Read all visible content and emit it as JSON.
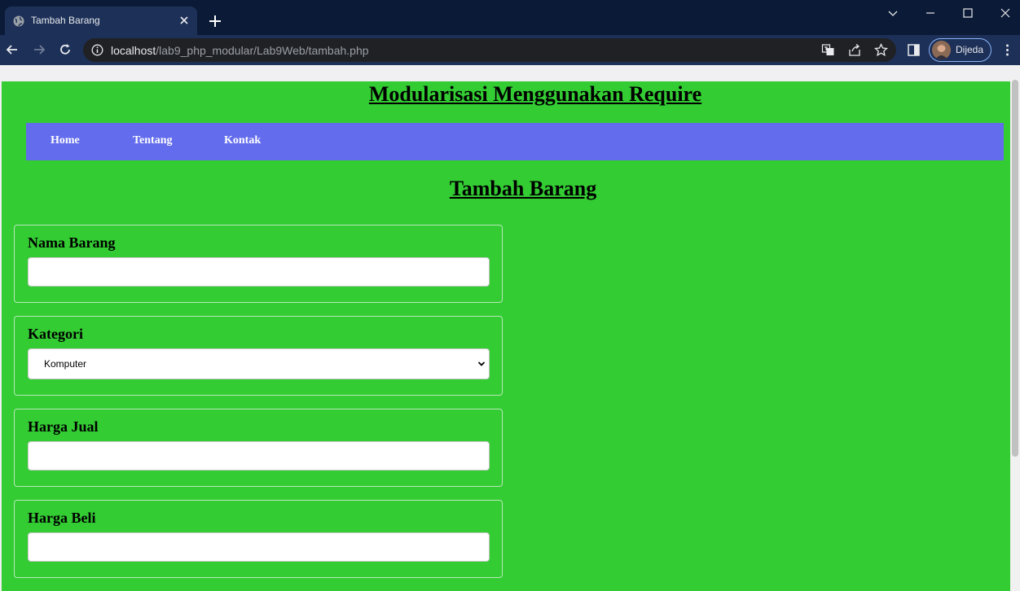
{
  "browser": {
    "tab_title": "Tambah Barang",
    "url_host": "localhost",
    "url_path": "/lab9_php_modular/Lab9Web/tambah.php",
    "profile_name": "Dijeda",
    "icons": [
      "globe-icon",
      "close-icon",
      "plus-icon",
      "chevron-down-icon",
      "minimize-icon",
      "maximize-icon",
      "window-close-icon",
      "back-icon",
      "forward-icon",
      "reload-icon",
      "info-icon",
      "translate-icon",
      "share-icon",
      "star-icon",
      "side-panel-icon",
      "kebab-menu-icon"
    ]
  },
  "page": {
    "site_title": "Modularisasi Menggunakan Require",
    "menu": [
      {
        "label": "Home"
      },
      {
        "label": "Tentang"
      },
      {
        "label": "Kontak"
      }
    ],
    "form_title": "Tambah Barang",
    "fields": [
      {
        "label": "Nama Barang",
        "type": "text",
        "value": ""
      },
      {
        "label": "Kategori",
        "type": "select",
        "value": "Komputer"
      },
      {
        "label": "Harga Jual",
        "type": "text",
        "value": ""
      },
      {
        "label": "Harga Beli",
        "type": "text",
        "value": ""
      }
    ]
  },
  "colors": {
    "page_bg": "#33cc33",
    "menu_bg": "#636ced",
    "chrome_dark": "#0b1a36",
    "chrome_toolbar": "#1d3058"
  }
}
